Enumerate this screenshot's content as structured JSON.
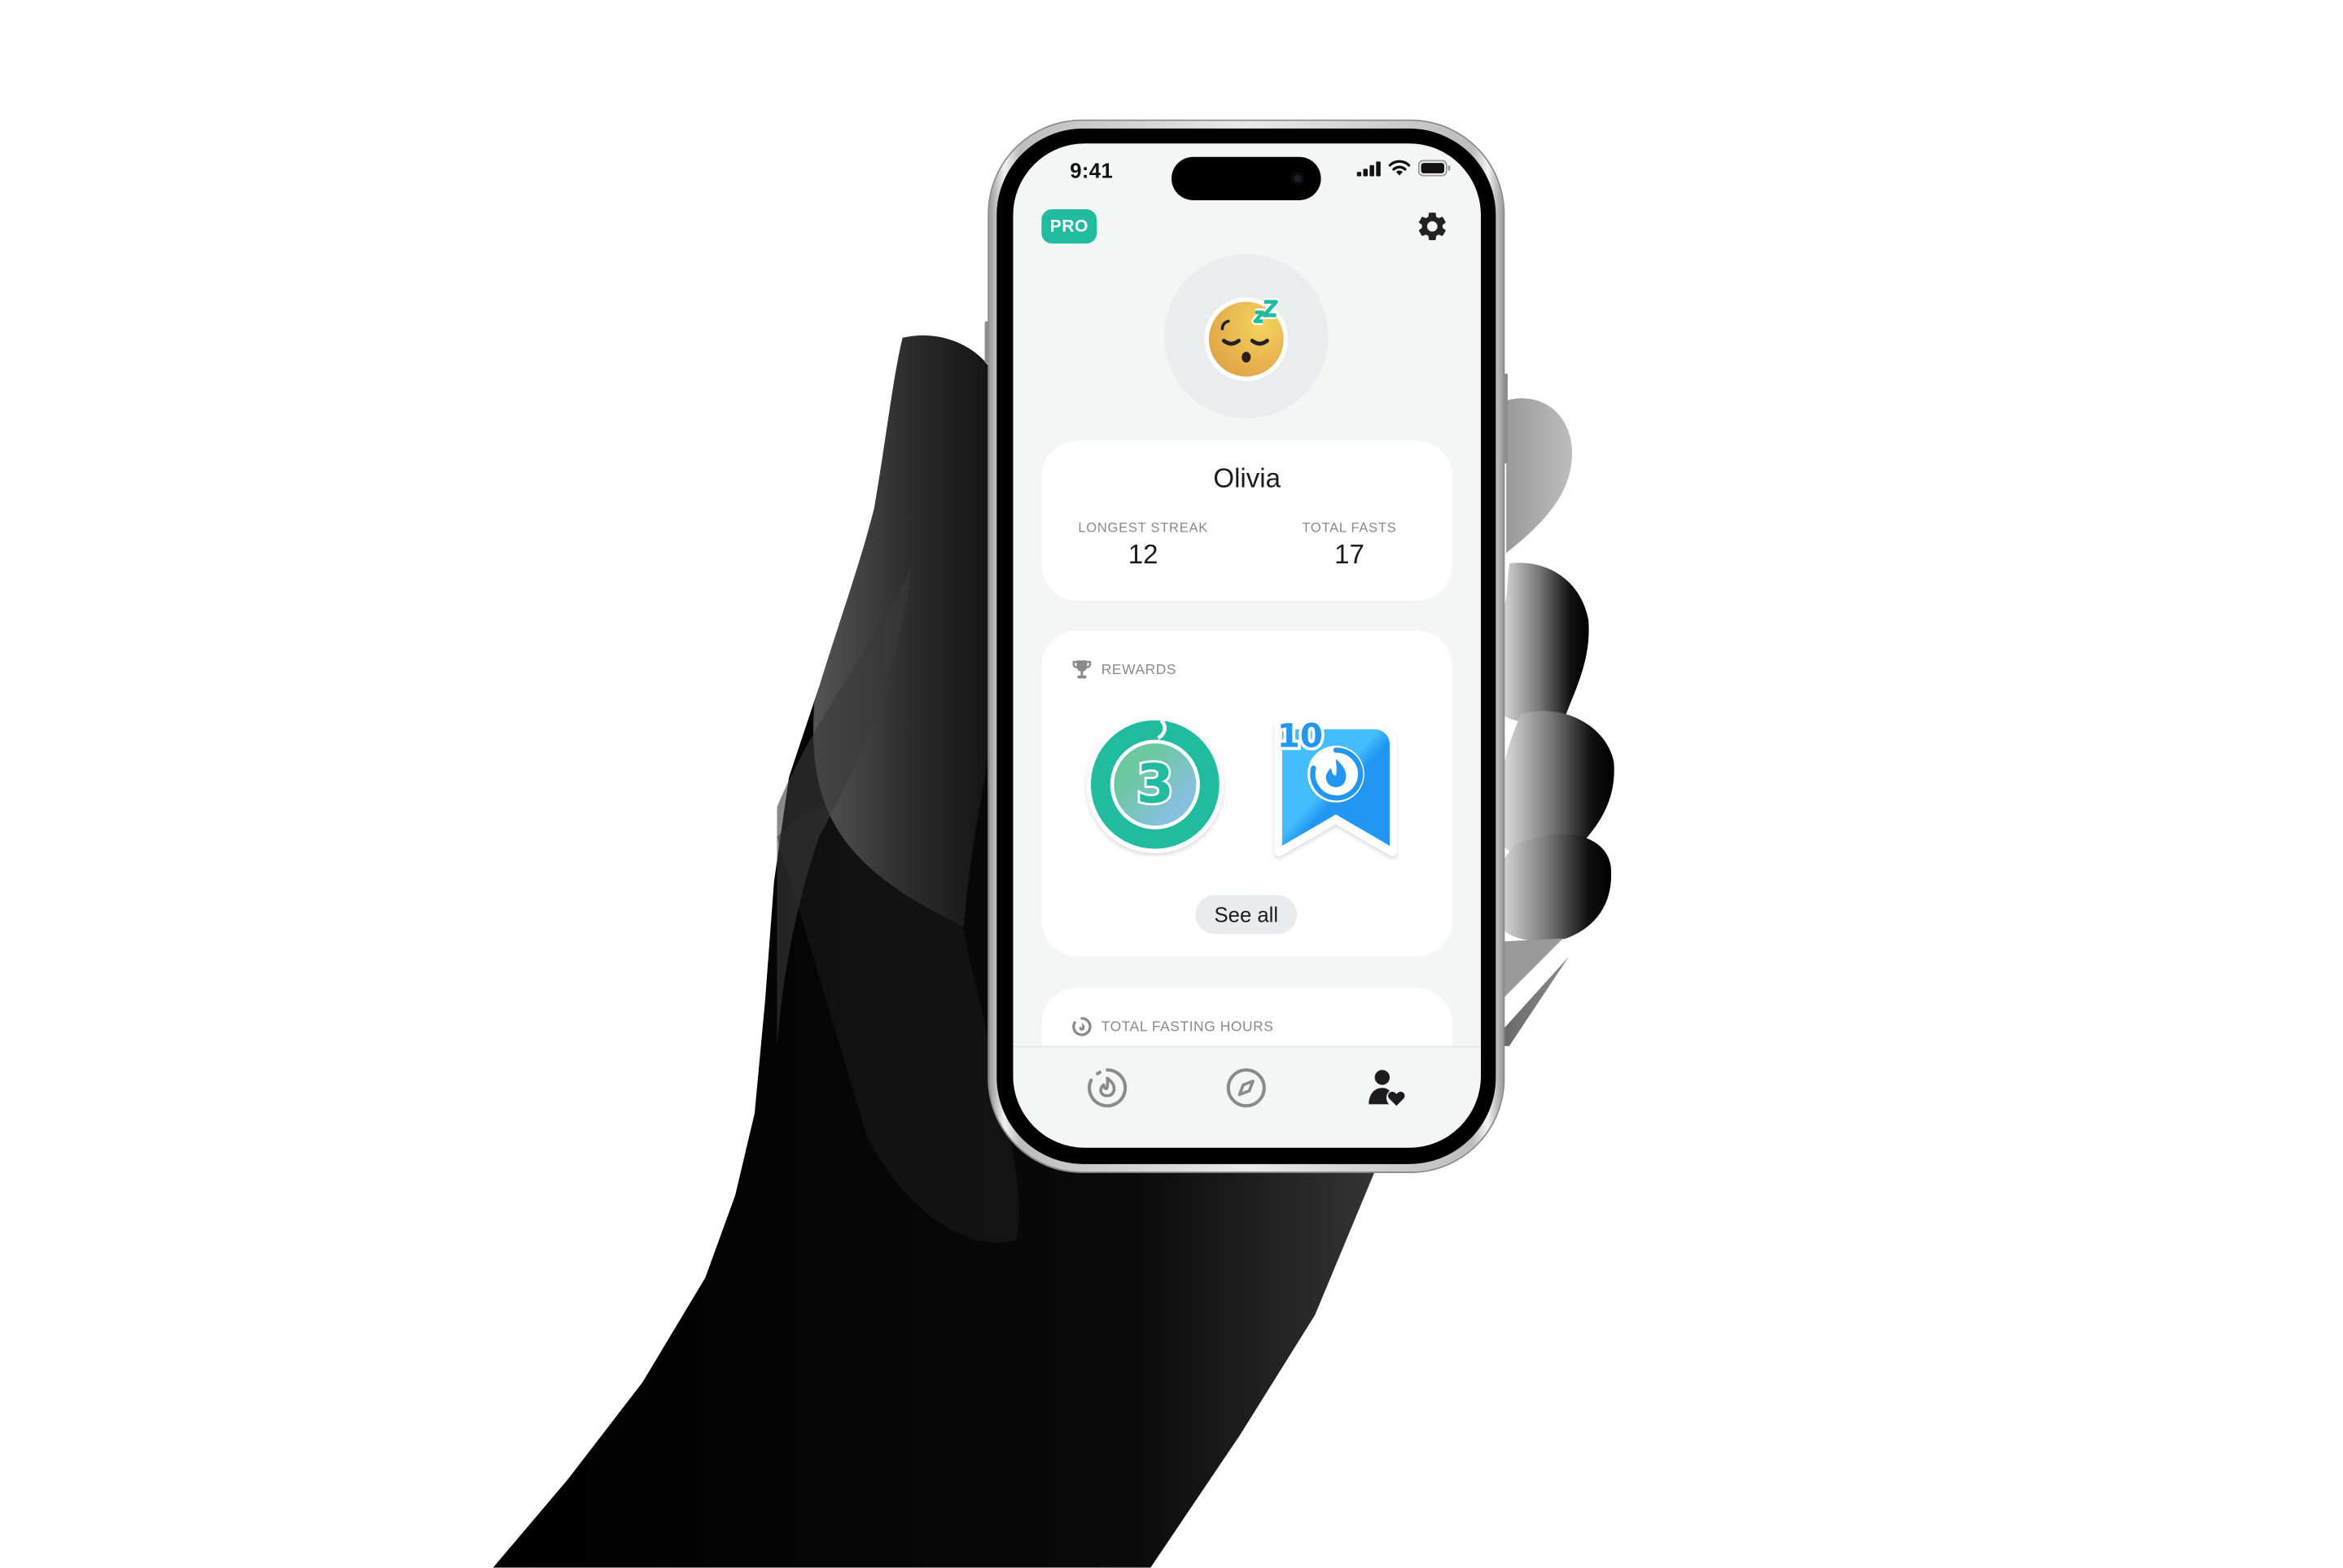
{
  "status_bar": {
    "time": "9:41",
    "icons": [
      "cellular-signal-icon",
      "wifi-icon",
      "battery-icon"
    ]
  },
  "header": {
    "pro_badge": "PRO",
    "settings_icon": "gear-icon"
  },
  "profile": {
    "avatar_icon": "sleeping-face-emoji",
    "name": "Olivia",
    "stats": [
      {
        "label": "LONGEST STREAK",
        "value": "12"
      },
      {
        "label": "TOTAL FASTS",
        "value": "17"
      }
    ]
  },
  "rewards": {
    "title": "REWARDS",
    "title_icon": "trophy-icon",
    "badges": [
      {
        "name": "3-day-ring-badge",
        "label": "3"
      },
      {
        "name": "10-fasts-ribbon-badge",
        "label": "10"
      }
    ],
    "see_all_label": "See all"
  },
  "fasting_hours": {
    "title": "TOTAL FASTING HOURS",
    "title_icon": "fasting-timer-icon"
  },
  "tab_bar": {
    "tabs": [
      {
        "name": "fasting",
        "icon": "fasting-timer-icon",
        "active": false
      },
      {
        "name": "explore",
        "icon": "compass-icon",
        "active": false
      },
      {
        "name": "profile",
        "icon": "profile-heart-icon",
        "active": true
      }
    ]
  },
  "colors": {
    "accent": "#21BC9F",
    "badge_blue": "#2196F3",
    "screen_bg": "#F4F5F5",
    "card_bg": "#FFFFFF",
    "text_primary": "#1C1C1E",
    "text_secondary": "#8A8A8E"
  }
}
